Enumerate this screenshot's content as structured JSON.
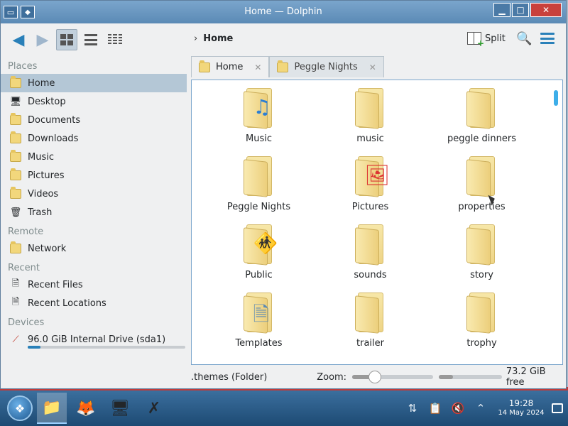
{
  "window": {
    "title": "Home — Dolphin",
    "app_icon": "folder-icon",
    "controls": {
      "pin": "◆",
      "minimize": "▁",
      "maximize": "□",
      "close": "✕"
    }
  },
  "toolbar": {
    "back_icon": "arrow-left-icon",
    "forward_icon": "arrow-right-icon",
    "breadcrumb_separator": "›",
    "breadcrumb": "Home",
    "split_label": "Split",
    "search_icon": "search-icon",
    "menu_icon": "hamburger-menu-icon"
  },
  "places": {
    "sections": [
      {
        "header": "Places",
        "items": [
          {
            "label": "Home",
            "icon": "home-folder-icon",
            "selected": true
          },
          {
            "label": "Desktop",
            "icon": "desktop-icon"
          },
          {
            "label": "Documents",
            "icon": "documents-folder-icon"
          },
          {
            "label": "Downloads",
            "icon": "downloads-folder-icon"
          },
          {
            "label": "Music",
            "icon": "music-folder-icon"
          },
          {
            "label": "Pictures",
            "icon": "pictures-folder-icon"
          },
          {
            "label": "Videos",
            "icon": "videos-folder-icon"
          },
          {
            "label": "Trash",
            "icon": "trash-icon"
          }
        ]
      },
      {
        "header": "Remote",
        "items": [
          {
            "label": "Network",
            "icon": "network-folder-icon"
          }
        ]
      },
      {
        "header": "Recent",
        "items": [
          {
            "label": "Recent Files",
            "icon": "recent-files-icon"
          },
          {
            "label": "Recent Locations",
            "icon": "recent-locations-icon"
          }
        ]
      },
      {
        "header": "Devices",
        "items": [
          {
            "label": "96.0 GiB Internal Drive (sda1)",
            "icon": "drive-icon",
            "usage": 0.08
          }
        ]
      }
    ]
  },
  "tabs": [
    {
      "label": "Home",
      "active": true
    },
    {
      "label": "Peggle Nights",
      "active": false
    }
  ],
  "files": [
    {
      "name": "Music",
      "emblem": "♫",
      "emblem_color": "#2c7fd4"
    },
    {
      "name": "music"
    },
    {
      "name": "peggle dinners"
    },
    {
      "name": "Peggle Nights"
    },
    {
      "name": "Pictures",
      "emblem": "🖼",
      "emblem_color": "#d33"
    },
    {
      "name": "properties"
    },
    {
      "name": "Public",
      "emblem": "🚸",
      "emblem_color": "#f1c40f"
    },
    {
      "name": "sounds"
    },
    {
      "name": "story"
    },
    {
      "name": "Templates",
      "emblem": "🗎",
      "emblem_color": "#5b8ab5"
    },
    {
      "name": "trailer"
    },
    {
      "name": "trophy"
    },
    {
      "name": ""
    },
    {
      "name": ""
    },
    {
      "name": ""
    }
  ],
  "statusbar": {
    "selection_text": ".themes (Folder)",
    "zoom_label": "Zoom:",
    "zoom_level": 0.28,
    "space_used": 0.22,
    "free_space": "73.2 GiB free"
  },
  "taskbar": {
    "apps": [
      {
        "name": "dolphin",
        "icon": "📁",
        "active": true
      },
      {
        "name": "firefox",
        "icon": "🦊",
        "active": false
      },
      {
        "name": "system-settings",
        "icon": "🖥",
        "active": false
      },
      {
        "name": "x-app",
        "icon": "✗",
        "active": false
      }
    ],
    "tray_icons": [
      "network-icon",
      "clipboard-icon",
      "volume-muted-icon",
      "chevron-up-icon"
    ],
    "time": "19:28",
    "date": "14 May 2024"
  }
}
